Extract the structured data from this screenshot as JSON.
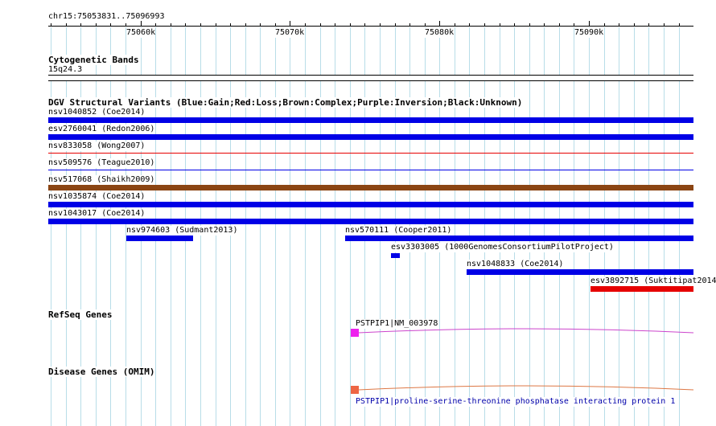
{
  "ruler": {
    "position": "chr15:75053831..75096993",
    "start": 75053831,
    "end": 75096993,
    "major_labels": [
      "75060k",
      "75070k",
      "75080k",
      "75090k"
    ],
    "major_values": [
      75060000,
      75070000,
      75080000,
      75090000
    ]
  },
  "cytoband": {
    "title": "Cytogenetic Bands",
    "band": "15q24.3"
  },
  "dgv": {
    "title": "DGV Structural Variants (Blue:Gain;Red:Loss;Brown:Complex;Purple:Inversion;Black:Unknown)",
    "colors": {
      "gain": "#0000e6",
      "loss": "#e60000",
      "complex": "#8b4513"
    },
    "variants": [
      {
        "label": "nsv1040852 (Coe2014)",
        "type": "gain",
        "start": 75053831,
        "end": 75096993,
        "thin": false
      },
      {
        "label": "esv2760041 (Redon2006)",
        "type": "gain",
        "start": 75053831,
        "end": 75096993,
        "thin": false
      },
      {
        "label": "nsv833058 (Wong2007)",
        "type": "loss",
        "start": 75053831,
        "end": 75096993,
        "thin": true
      },
      {
        "label": "nsv509576 (Teague2010)",
        "type": "gain",
        "start": 75053831,
        "end": 75096993,
        "thin": true
      },
      {
        "label": "nsv517068 (Shaikh2009)",
        "type": "complex",
        "start": 75053831,
        "end": 75096993,
        "thin": false
      },
      {
        "label": "nsv1035874 (Coe2014)",
        "type": "gain",
        "start": 75053831,
        "end": 75096993,
        "thin": false
      },
      {
        "label": "nsv1043017 (Coe2014)",
        "type": "gain",
        "start": 75053831,
        "end": 75096993,
        "thin": false
      },
      {
        "label": "nsv974603 (Sudmant2013)",
        "type": "gain",
        "start": 75059050,
        "end": 75063500,
        "thin": false
      },
      {
        "label": "nsv570111 (Cooper2011)",
        "type": "gain",
        "start": 75073700,
        "end": 75096993,
        "thin": false
      },
      {
        "label": "esv3303005 (1000GenomesConsortiumPilotProject)",
        "type": "gain",
        "start": 75076750,
        "end": 75077350,
        "thin": false
      },
      {
        "label": "nsv1048833 (Coe2014)",
        "type": "gain",
        "start": 75081800,
        "end": 75096993,
        "thin": false
      },
      {
        "label": "esv3892715 (Suktitipat2014)",
        "type": "loss",
        "start": 75090100,
        "end": 75096993,
        "thin": false
      }
    ]
  },
  "refseq": {
    "title": "RefSeq Genes",
    "gene_label": "PSTPIP1|NM_003978",
    "color": "#ee22ee",
    "line_color": "#cc44cc",
    "start": 75074000
  },
  "omim": {
    "title": "Disease Genes (OMIM)",
    "gene_label": "PSTPIP1|proline-serine-threonine phosphatase interacting protein 1",
    "color": "#ee6644",
    "line_color": "#dd7744",
    "label_color": "#0000aa",
    "start": 75074000
  },
  "grid_color": "#b8dde8"
}
